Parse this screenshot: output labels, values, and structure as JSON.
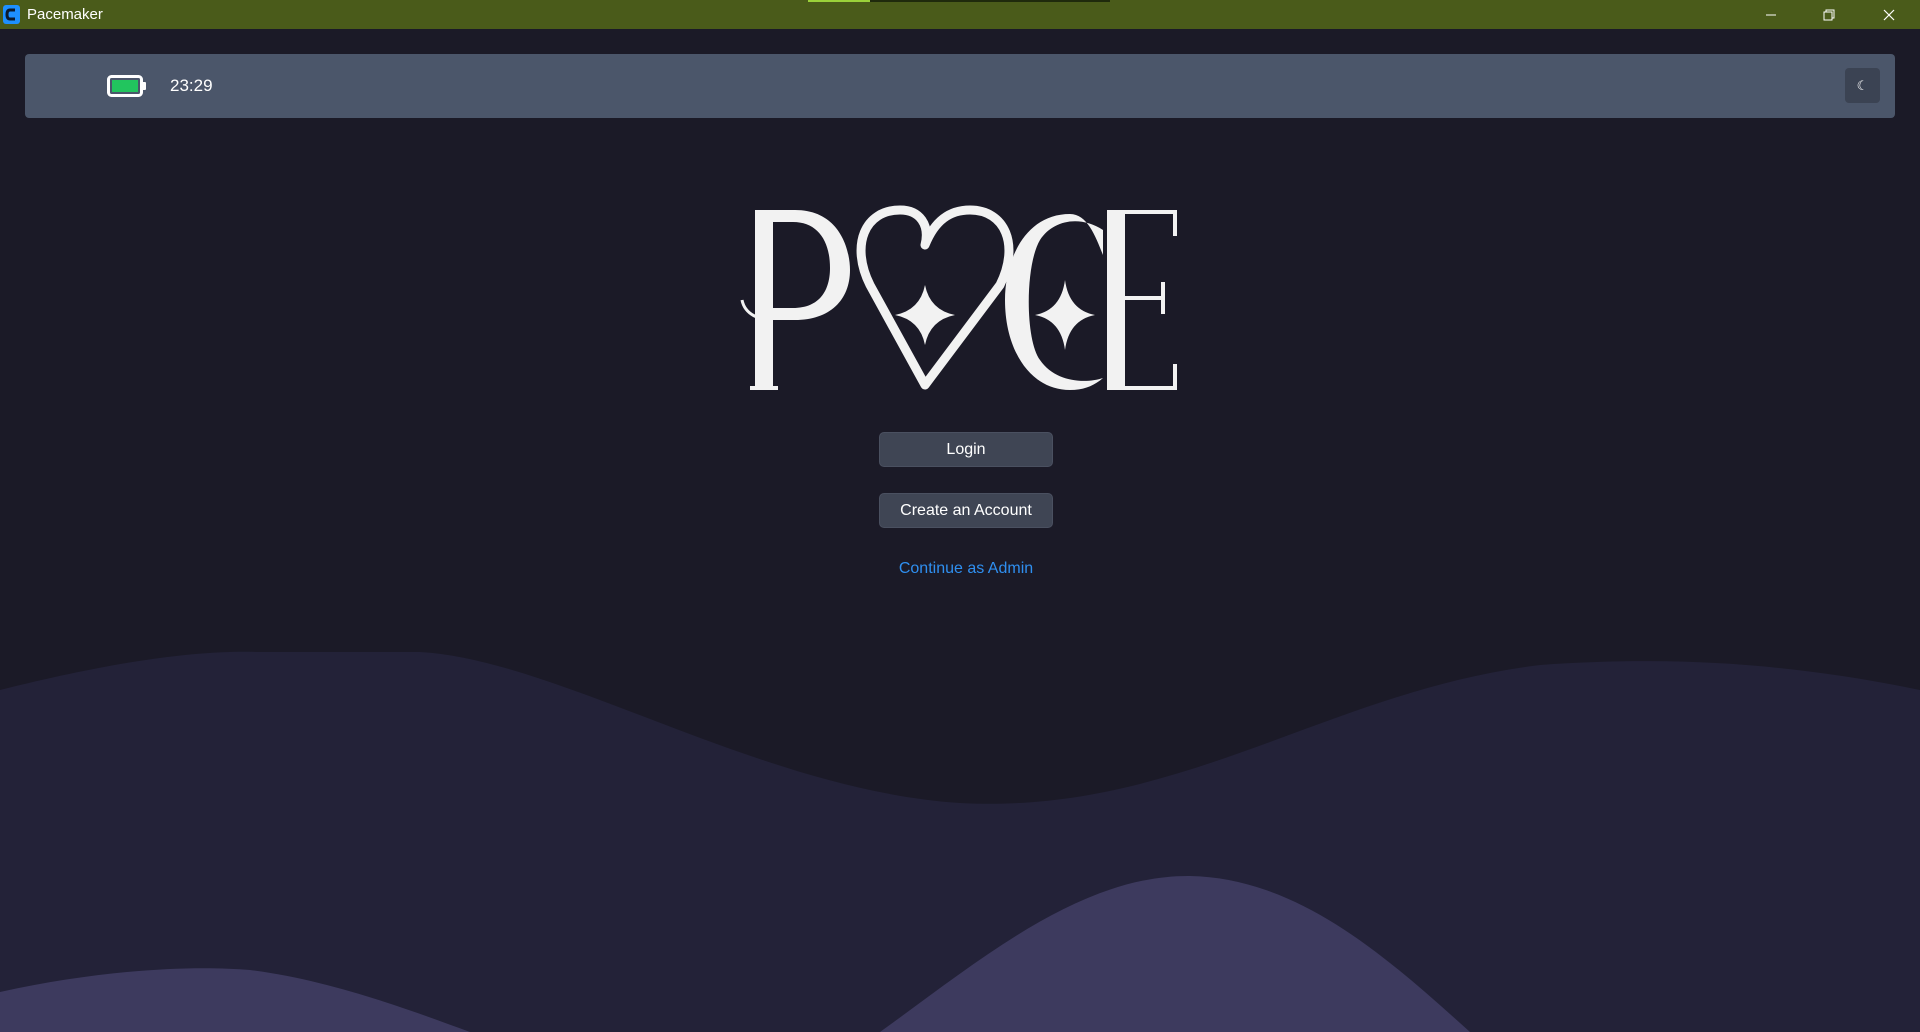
{
  "window": {
    "title": "Pacemaker",
    "controls": [
      "minimize",
      "restore",
      "close"
    ]
  },
  "statusbar": {
    "battery_icon": "battery-full-icon",
    "battery_color": "#22c55e",
    "time": "23:29",
    "theme_toggle_icon": "moon-icon",
    "theme_toggle_glyph": "☾"
  },
  "hero": {
    "logo_text": "PACE",
    "logo_icon": "heart-sparkle-icon"
  },
  "actions": {
    "login_label": "Login",
    "create_account_label": "Create an Account",
    "admin_link_label": "Continue as Admin"
  },
  "colors": {
    "titlebar": "#4a5b1a",
    "background": "#1b1a27",
    "statusbar": "#4b566a",
    "link": "#2f8ff0",
    "wave_back": "#232238",
    "wave_front": "#3d3a5e"
  }
}
